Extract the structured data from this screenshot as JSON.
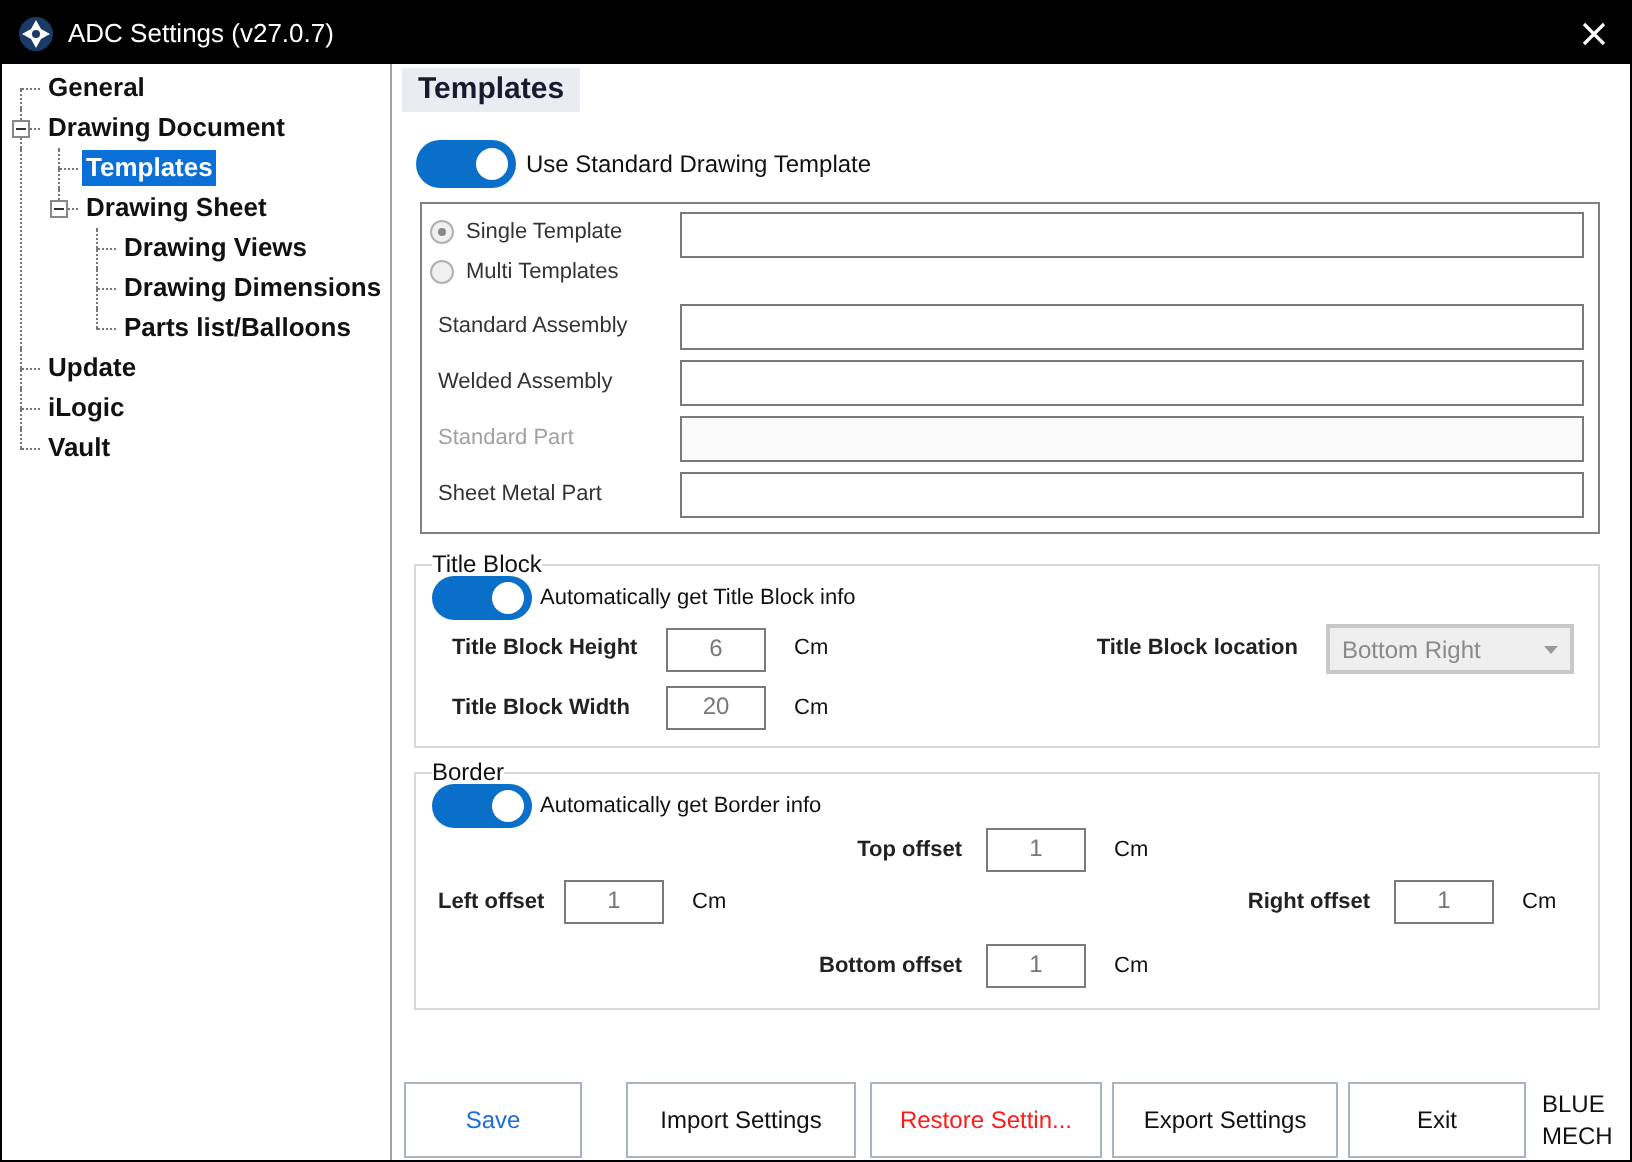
{
  "window": {
    "title": "ADC Settings (v27.0.7)"
  },
  "tree": [
    {
      "label": "General",
      "selected": false
    },
    {
      "label": "Drawing Document",
      "selected": false,
      "expanded": true,
      "children": [
        {
          "label": "Templates",
          "selected": true
        },
        {
          "label": "Drawing Sheet",
          "selected": false,
          "expanded": true,
          "children": [
            {
              "label": "Drawing Views",
              "selected": false
            },
            {
              "label": "Drawing Dimensions",
              "selected": false
            },
            {
              "label": "Parts list/Balloons",
              "selected": false
            }
          ]
        }
      ]
    },
    {
      "label": "Update",
      "selected": false
    },
    {
      "label": "iLogic",
      "selected": false
    },
    {
      "label": "Vault",
      "selected": false
    }
  ],
  "page_header": "Templates",
  "template_toggle": {
    "label": "Use Standard Drawing Template",
    "on": true
  },
  "template_modes": [
    {
      "label": "Single Template",
      "selected": true
    },
    {
      "label": "Multi Templates",
      "selected": false
    }
  ],
  "template_paths": [
    {
      "label": "Standard Assembly",
      "disabled": false
    },
    {
      "label": "Welded Assembly",
      "disabled": false
    },
    {
      "label": "Standard Part",
      "disabled": true
    },
    {
      "label": "Sheet Metal Part",
      "disabled": false
    }
  ],
  "title_block": {
    "legend": "Title Block",
    "toggle": {
      "label": "Automatically get Title Block info",
      "on": true
    },
    "height": {
      "label": "Title Block Height",
      "value": "6",
      "unit": "Cm"
    },
    "width": {
      "label": "Title Block Width",
      "value": "20",
      "unit": "Cm"
    },
    "location": {
      "label": "Title Block location",
      "value": "Bottom Right",
      "disabled": true
    }
  },
  "border": {
    "legend": "Border",
    "toggle": {
      "label": "Automatically get Border info",
      "on": true
    },
    "top": {
      "label": "Top offset",
      "value": "1",
      "unit": "Cm"
    },
    "left": {
      "label": "Left offset",
      "value": "1",
      "unit": "Cm"
    },
    "right": {
      "label": "Right offset",
      "value": "1",
      "unit": "Cm"
    },
    "bottom": {
      "label": "Bottom offset",
      "value": "1",
      "unit": "Cm"
    }
  },
  "buttons": [
    {
      "label": "Save",
      "kind": "primary"
    },
    {
      "label": "Import Settings",
      "kind": "normal"
    },
    {
      "label": "Restore Settin...",
      "kind": "danger"
    },
    {
      "label": "Export Settings",
      "kind": "normal"
    },
    {
      "label": "Exit",
      "kind": "normal"
    }
  ],
  "brand": "BLUE MECH"
}
